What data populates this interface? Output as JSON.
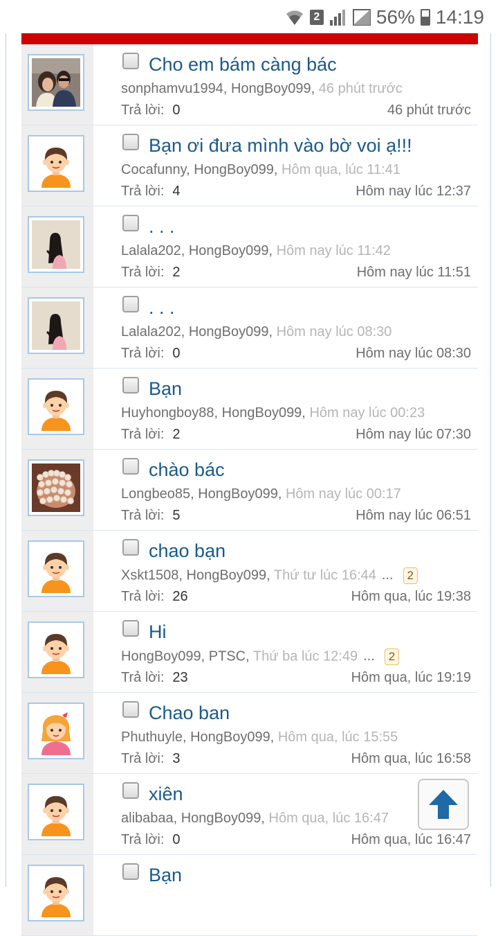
{
  "status_bar": {
    "sim_label": "2",
    "battery": "56%",
    "time": "14:19"
  },
  "colors": {
    "header_red": "#cc0000",
    "title_blue": "#1a5a8c",
    "scroll_arrow": "#1f6aa5"
  },
  "threads": [
    {
      "title": "Cho em bám càng bác",
      "participants": "sonphamvu1994, HongBoy099,",
      "date": "46 phút trước",
      "replies_label": "Trả lời:",
      "replies": "0",
      "last_post": "46 phút trước",
      "avatar": "photo-couple"
    },
    {
      "title": "Bạn ơi đưa mình vào bờ voi ạ!!!",
      "participants": "Cocafunny, HongBoy099,",
      "date": "Hôm qua, lúc 11:41",
      "replies_label": "Trả lời:",
      "replies": "4",
      "last_post": "Hôm nay lúc 12:37",
      "avatar": "default-boy"
    },
    {
      "title": ". . .",
      "participants": "Lalala202, HongBoy099,",
      "date": "Hôm nay lúc 11:42",
      "replies_label": "Trả lời:",
      "replies": "2",
      "last_post": "Hôm nay lúc 11:51",
      "avatar": "photo-girl"
    },
    {
      "title": ". . .",
      "participants": "Lalala202, HongBoy099,",
      "date": "Hôm nay lúc 08:30",
      "replies_label": "Trả lời:",
      "replies": "0",
      "last_post": "Hôm nay lúc 08:30",
      "avatar": "photo-girl"
    },
    {
      "title": "Bạn",
      "participants": "Huyhongboy88, HongBoy099,",
      "date": "Hôm nay lúc 00:23",
      "replies_label": "Trả lời:",
      "replies": "2",
      "last_post": "Hôm nay lúc 07:30",
      "avatar": "default-boy"
    },
    {
      "title": "chào bác",
      "participants": "Longbeo85, HongBoy099,",
      "date": "Hôm nay lúc 00:17",
      "replies_label": "Trả lời:",
      "replies": "5",
      "last_post": "Hôm nay lúc 06:51",
      "avatar": "photo-beads"
    },
    {
      "title": "chao bạn",
      "participants": "Xskt1508, HongBoy099,",
      "date": "Thứ tư lúc 16:44",
      "ellipsis": "...",
      "page_badge": "2",
      "replies_label": "Trả lời:",
      "replies": "26",
      "last_post": "Hôm qua, lúc 19:38",
      "avatar": "default-boy"
    },
    {
      "title": "Hi",
      "participants": "HongBoy099, PTSC,",
      "date": "Thứ ba lúc 12:49",
      "ellipsis": "...",
      "page_badge": "2",
      "replies_label": "Trả lời:",
      "replies": "23",
      "last_post": "Hôm qua, lúc 19:19",
      "avatar": "default-boy"
    },
    {
      "title": "Chao ban",
      "participants": "Phuthuyle, HongBoy099,",
      "date": "Hôm qua, lúc 15:55",
      "replies_label": "Trả lời:",
      "replies": "3",
      "last_post": "Hôm qua, lúc 16:58",
      "avatar": "default-girl"
    },
    {
      "title": "xiên",
      "participants": "alibabaa, HongBoy099,",
      "date": "Hôm qua, lúc 16:47",
      "replies_label": "Trả lời:",
      "replies": "0",
      "last_post": "Hôm qua, lúc 16:47",
      "avatar": "default-boy"
    },
    {
      "title": "Bạn",
      "participants": "",
      "date": "",
      "replies_label": "",
      "replies": "",
      "last_post": "",
      "avatar": "default-boy"
    }
  ],
  "scroll_top_icon": "arrow-up-icon"
}
